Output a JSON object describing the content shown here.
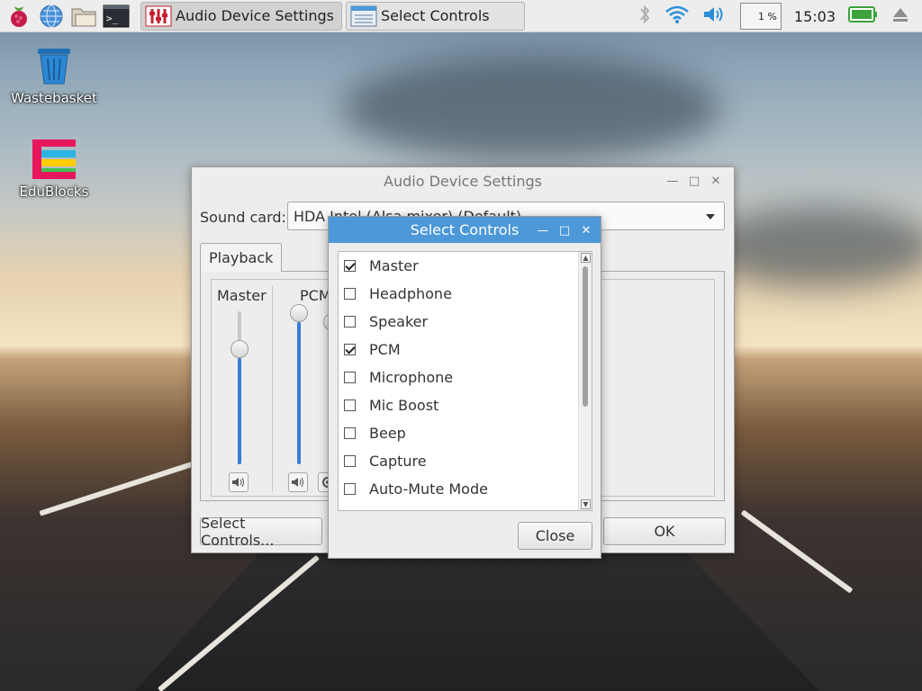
{
  "taskbar": {
    "tasks": [
      {
        "label": "Audio Device Settings",
        "icon": "mixer-icon"
      },
      {
        "label": "Select Controls",
        "icon": "list-dialog-icon"
      }
    ],
    "cpu_usage": "1 %",
    "clock": "15:03"
  },
  "desktop": {
    "icons": [
      {
        "label": "Wastebasket",
        "icon": "trash-icon"
      },
      {
        "label": "EduBlocks",
        "icon": "edublocks-icon"
      }
    ]
  },
  "audio_settings": {
    "title": "Audio Device Settings",
    "sound_card_label": "Sound card:",
    "sound_card_value": "HDA Intel (Alsa mixer) (Default)",
    "tab_label": "Playback",
    "channels": [
      {
        "label": "Master",
        "level": 0.85
      },
      {
        "label": "PCM",
        "level": 1.0
      }
    ],
    "select_controls_button": "Select Controls...",
    "ok_button": "OK"
  },
  "select_controls": {
    "title": "Select Controls",
    "items": [
      {
        "label": "Master",
        "checked": true
      },
      {
        "label": "Headphone",
        "checked": false
      },
      {
        "label": "Speaker",
        "checked": false
      },
      {
        "label": "PCM",
        "checked": true
      },
      {
        "label": "Microphone",
        "checked": false
      },
      {
        "label": "Mic Boost",
        "checked": false
      },
      {
        "label": "Beep",
        "checked": false
      },
      {
        "label": "Capture",
        "checked": false
      },
      {
        "label": "Auto-Mute Mode",
        "checked": false
      }
    ],
    "close_button": "Close"
  },
  "colors": {
    "accent": "#4d98d8",
    "slider_fill": "#3a7bd5"
  }
}
